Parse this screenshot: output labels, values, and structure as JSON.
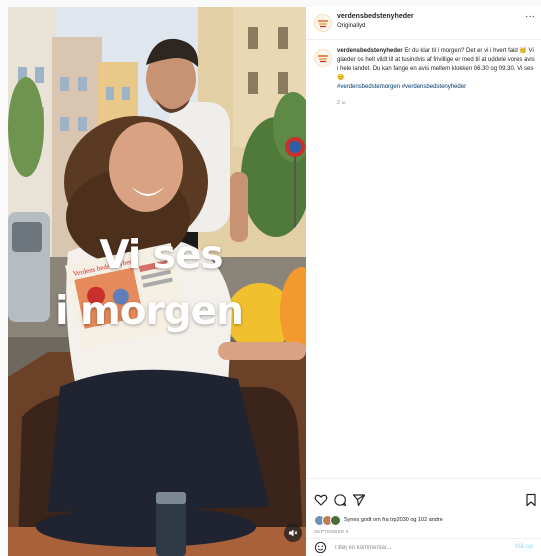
{
  "post": {
    "username": "verdensbedstenyheder",
    "audio_label": "Originallyd",
    "more_icon": "more-horizontal-icon",
    "media": {
      "overlay_line1": "Vi ses",
      "overlay_line2": "i morgen",
      "book_title": "Verdens bedste nyheder",
      "mute_icon": "speaker-muted-icon"
    },
    "caption": {
      "username": "verdensbedstenyheder",
      "text": " Er du klar til i morgen? Det er vi i hvert fald 🥳 Vi glæder os helt vildt til at tusindvis af frivillige er med til at uddele vores avis i hele landet. Du kan fange en avis mellem klokken 06.30 og 09.30. Vi ses 😊",
      "hashtags": "#verdensbedstemorgen #verdensbedstenyheder",
      "time_ago": "2 u."
    },
    "actions": {
      "like_icon": "heart-icon",
      "comment_icon": "comment-icon",
      "share_icon": "send-icon",
      "save_icon": "bookmark-icon"
    },
    "likes_text": "Synes godt om fra trp2030 og 102 andre",
    "date": "SEPTEMBER 6",
    "comment": {
      "emoji_icon": "smiley-icon",
      "placeholder": "Tilføj en kommentar...",
      "publish_label": "Slå op"
    },
    "colors": {
      "link": "#00376b",
      "publish_disabled": "#b2dffc",
      "muted_text": "#8e8e8e",
      "text": "#262626"
    }
  }
}
